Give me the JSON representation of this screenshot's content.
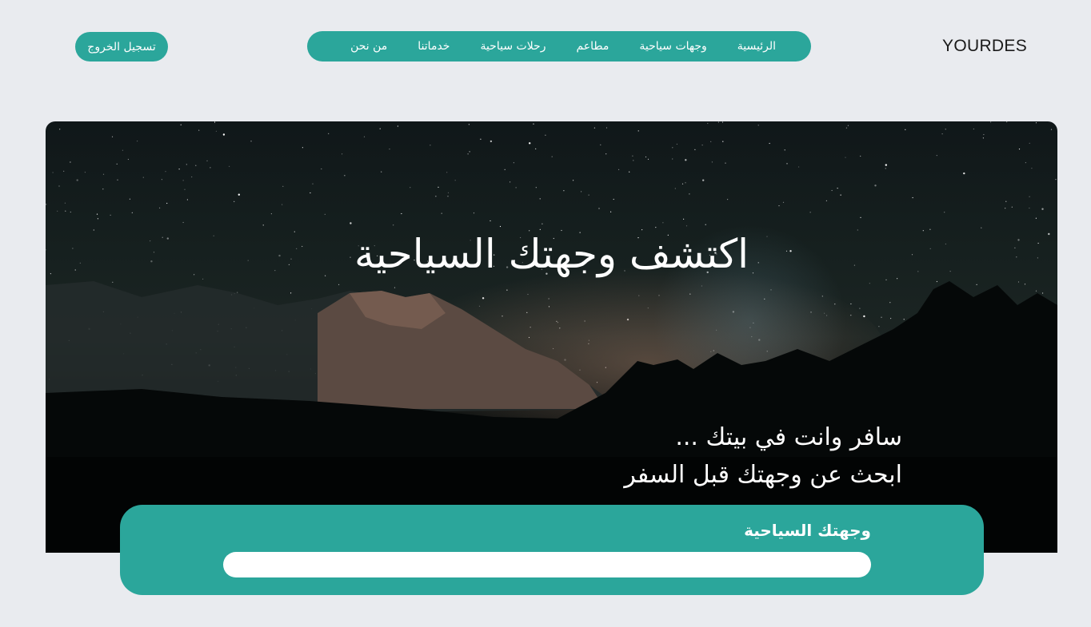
{
  "header": {
    "logo": "YOURDES",
    "nav": [
      "الرئيسية",
      "وجهات سياحية",
      "مطاعم",
      "رحلات سياحية",
      "خدماتنا",
      "من نحن"
    ],
    "logout_label": "تسجيل الخروج"
  },
  "hero": {
    "title": "اكتشف وجهتك السياحية",
    "subtitle_line1": "سافر وانت في بيتك ...",
    "subtitle_line2": "ابحث عن وجهتك قبل السفر"
  },
  "search": {
    "label": "وجهتك السياحية",
    "value": "",
    "placeholder": ""
  },
  "colors": {
    "accent": "#2ba69b",
    "background": "#e9ebef"
  }
}
